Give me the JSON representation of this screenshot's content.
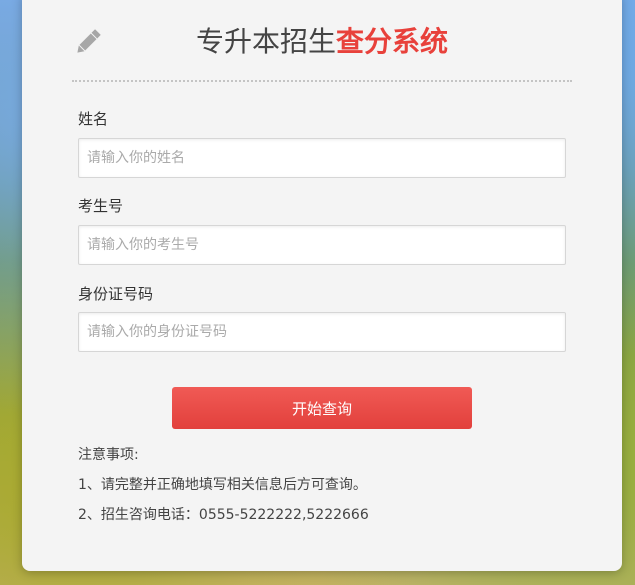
{
  "header": {
    "title_plain": "专升本招生",
    "title_highlight": "查分系统",
    "icon": "pencil-icon"
  },
  "form": {
    "name": {
      "label": "姓名",
      "placeholder": "请输入你的姓名",
      "value": ""
    },
    "exam_no": {
      "label": "考生号",
      "placeholder": "请输入你的考生号",
      "value": ""
    },
    "id_no": {
      "label": "身份证号码",
      "placeholder": "请输入你的身份证号码",
      "value": ""
    },
    "submit_label": "开始查询"
  },
  "notes": {
    "heading": "注意事项:",
    "items": [
      "1、请完整并正确地填写相关信息后方可查询。",
      "2、招生咨询电话：0555-5222222,5222666"
    ]
  },
  "colors": {
    "accent": "#e8413b",
    "button": "#e94a45",
    "card_bg": "#f4f4f4"
  }
}
